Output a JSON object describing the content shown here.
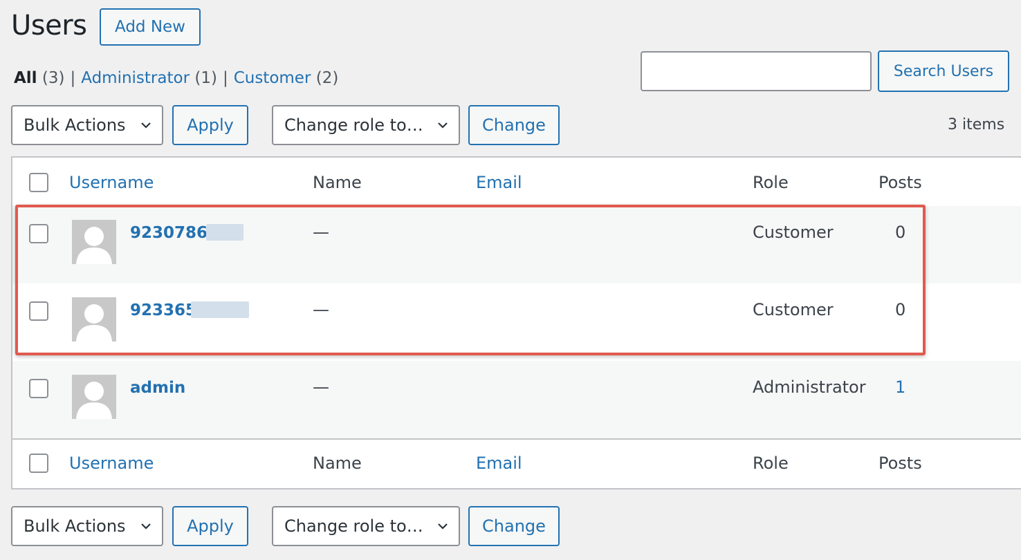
{
  "header": {
    "title": "Users",
    "add_new_label": "Add New"
  },
  "filters": [
    {
      "label": "All",
      "count": "(3)",
      "current": true
    },
    {
      "label": "Administrator",
      "count": "(1)",
      "current": false
    },
    {
      "label": "Customer",
      "count": "(2)",
      "current": false
    }
  ],
  "filter_separator": "|",
  "search": {
    "value": "",
    "button_label": "Search Users"
  },
  "top_actions": {
    "bulk_select": "Bulk Actions",
    "apply_label": "Apply",
    "role_select": "Change role to…",
    "change_label": "Change"
  },
  "bottom_actions": {
    "bulk_select": "Bulk Actions",
    "apply_label": "Apply",
    "role_select": "Change role to…",
    "change_label": "Change"
  },
  "items_count": "3 items",
  "table": {
    "columns": {
      "username": "Username",
      "name": "Name",
      "email": "Email",
      "role": "Role",
      "posts": "Posts"
    },
    "rows": [
      {
        "username": "92307867",
        "name": "—",
        "email": "",
        "role": "Customer",
        "posts": "0"
      },
      {
        "username": "923365",
        "name": "—",
        "email": "",
        "role": "Customer",
        "posts": "0"
      },
      {
        "username": "admin",
        "name": "—",
        "email": "",
        "role": "Administrator",
        "posts": "1"
      }
    ]
  },
  "colors": {
    "link": "#2271b1",
    "highlight": "#e05a50",
    "background": "#f0f0f1"
  }
}
